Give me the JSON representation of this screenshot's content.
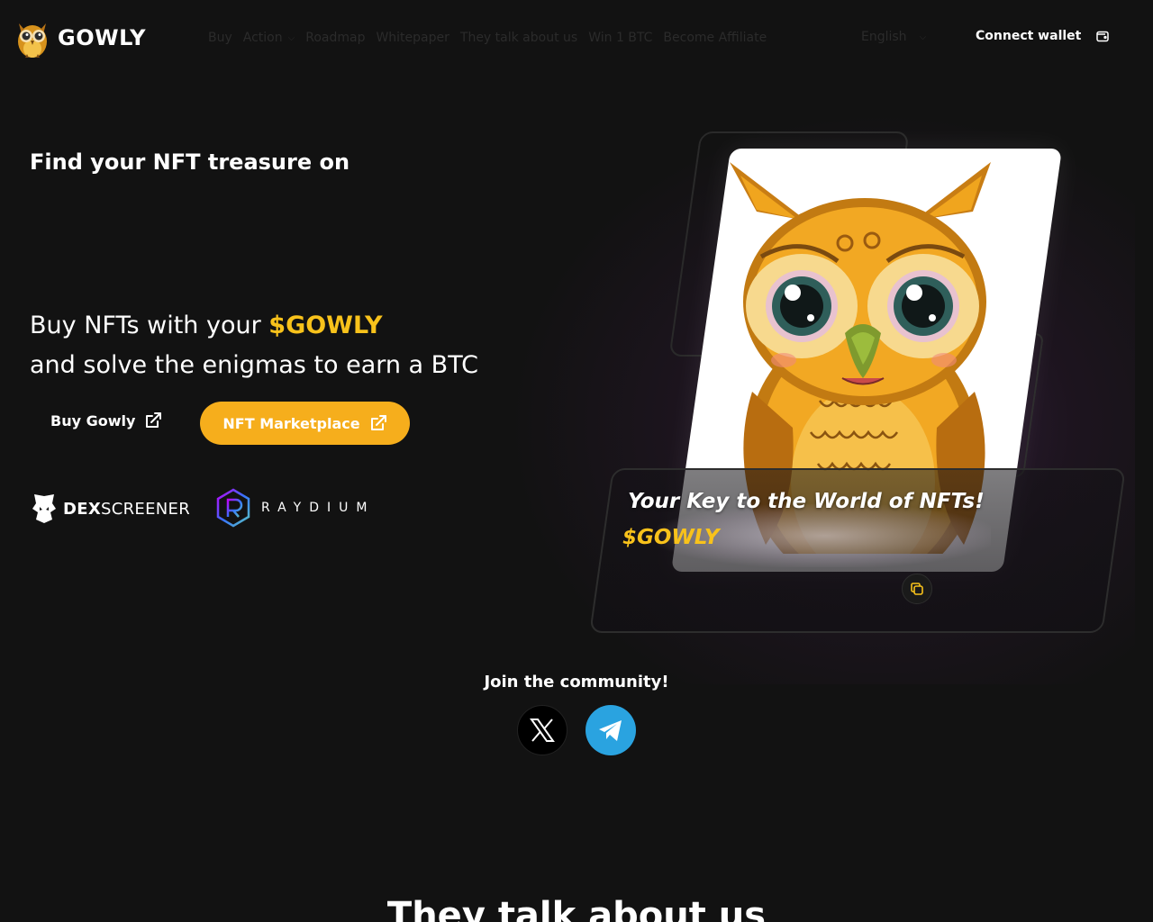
{
  "header": {
    "brand": "GOWLY",
    "nav": [
      {
        "label": "Buy"
      },
      {
        "label": "Action",
        "has_dropdown": true
      },
      {
        "label": "Roadmap"
      },
      {
        "label": "Whitepaper"
      },
      {
        "label": "They talk about us"
      },
      {
        "label": "Win 1 BTC"
      },
      {
        "label": "Become Affiliate"
      }
    ],
    "language": "English",
    "connect_label": "Connect wallet"
  },
  "hero": {
    "title": "Find your NFT treasure on",
    "subtitle_prefix": "Buy NFTs with your ",
    "subtitle_token": "$GOWLY",
    "subtitle_line2": "and solve the enigmas to earn a BTC",
    "buy_label": "Buy Gowly",
    "market_label": "NFT Marketplace",
    "partners": {
      "dex_bold": "DEX",
      "dex_rest": "SCREENER",
      "raydium": "RAYDIUM"
    }
  },
  "card": {
    "tagline": "Your Key to the World of NFTs!",
    "token": "$GOWLY"
  },
  "community": {
    "title": "Join the community!",
    "links": [
      {
        "icon": "x-icon"
      },
      {
        "icon": "telegram-icon"
      }
    ]
  },
  "section": {
    "title": "They talk about us"
  },
  "colors": {
    "background": "#121212",
    "accent": "#f8c21b",
    "button": "#f6ae1c",
    "telegram": "#2aa3e0"
  }
}
